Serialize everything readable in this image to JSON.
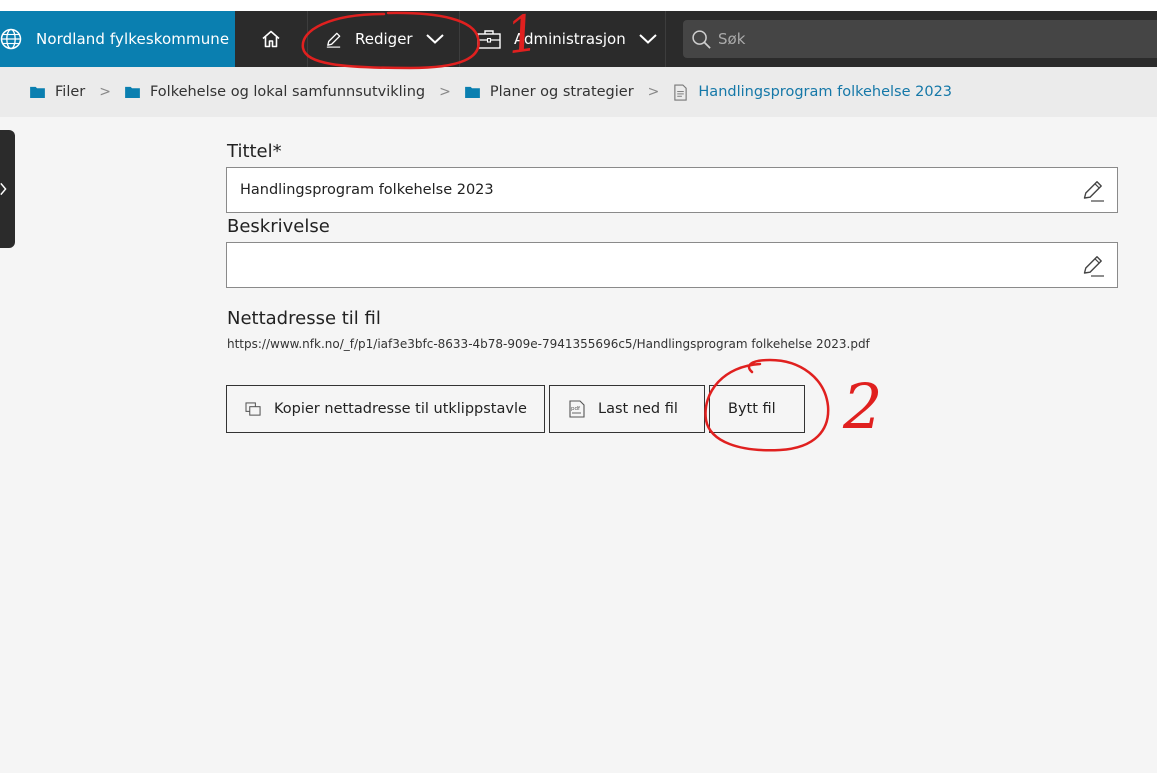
{
  "brand": {
    "name": "Nordland fylkeskommune",
    "icon": "globe-icon"
  },
  "nav": {
    "home_icon": "home-icon",
    "rediger_label": "Rediger",
    "administrasjon_label": "Administrasjon",
    "search_placeholder": "Søk"
  },
  "breadcrumb": {
    "items": [
      "Filer",
      "Folkehelse og lokal samfunnsutvikling",
      "Planer og strategier"
    ],
    "current": "Handlingsprogram folkehelse 2023",
    "separator": ">"
  },
  "form": {
    "title_label": "Tittel",
    "required_mark": "*",
    "title_value": "Handlingsprogram folkehelse 2023",
    "description_label": "Beskrivelse",
    "description_value": "",
    "url_label": "Nettadresse til fil",
    "url_value": "https://www.nfk.no/_f/p1/iaf3e3bfc-8633-4b78-909e-7941355696c5/Handlingsprogram folkehelse 2023.pdf"
  },
  "actions": {
    "copy_label": "Kopier nettadresse til utklippstavle",
    "download_label": "Last ned fil",
    "replace_label": "Bytt fil"
  },
  "annotations": {
    "mark_1": "1",
    "mark_2": "2",
    "color": "#e0201f"
  },
  "colors": {
    "brand": "#0a7fb0",
    "navbar": "#2b2b2b",
    "link": "#1578a8",
    "folder": "#0a7fb0"
  }
}
